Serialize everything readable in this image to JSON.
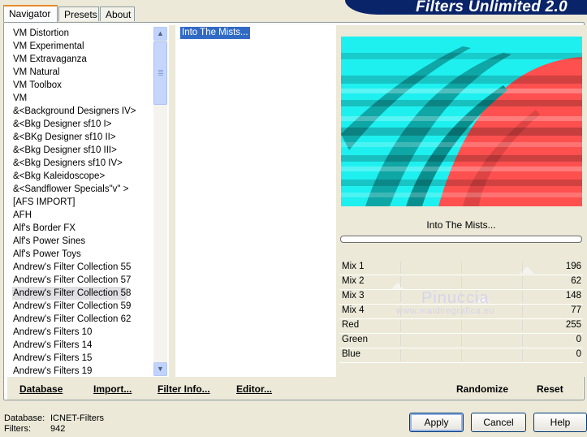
{
  "banner": {
    "title": "Filters Unlimited 2.0"
  },
  "tabs": [
    {
      "label": "Navigator"
    },
    {
      "label": "Presets"
    },
    {
      "label": "About"
    }
  ],
  "filter_list": {
    "items": [
      "VM Distortion",
      "VM Experimental",
      "VM Extravaganza",
      "VM Natural",
      "VM Toolbox",
      "VM",
      "&<Background Designers IV>",
      "&<Bkg Designer sf10 I>",
      "&<BKg Designer sf10 II>",
      "&<Bkg Designer sf10 III>",
      "&<Bkg Designers sf10 IV>",
      "&<Bkg Kaleidoscope>",
      "&<Sandflower Specials\"v\" >",
      "[AFS IMPORT]",
      "AFH",
      "Alf's Border FX",
      "Alf's Power Sines",
      "Alf's Power Toys",
      "Andrew's Filter Collection 55",
      "Andrew's Filter Collection 57",
      "Andrew's Filter Collection 58",
      "Andrew's Filter Collection 59",
      "Andrew's Filter Collection 62",
      "Andrew's Filters 10",
      "Andrew's Filters 14",
      "Andrew's Filters 15",
      "Andrew's Filters 19"
    ],
    "selected": "Andrew's Filter Collection 58"
  },
  "effect_list": {
    "selected": "Into The Mists..."
  },
  "filter_name": "Into The Mists...",
  "progress": 0,
  "sliders": [
    {
      "label": "Mix 1",
      "value": "196"
    },
    {
      "label": "Mix 2",
      "value": "62"
    },
    {
      "label": "Mix 3",
      "value": "148"
    },
    {
      "label": "Mix 4",
      "value": "77"
    },
    {
      "label": "Red",
      "value": "255"
    },
    {
      "label": "Green",
      "value": "0"
    },
    {
      "label": "Blue",
      "value": "0"
    }
  ],
  "watermark": {
    "name": "Pinuccia",
    "site": "www.maidiregrafica.eu"
  },
  "buttons": {
    "database": "Database",
    "import": "Import...",
    "filter_info": "Filter Info...",
    "editor": "Editor...",
    "randomize": "Randomize",
    "reset": "Reset",
    "apply": "Apply",
    "cancel": "Cancel",
    "help": "Help"
  },
  "status": {
    "database_label": "Database:",
    "database_value": "ICNET-Filters",
    "filters_label": "Filters:",
    "filters_value": "942"
  },
  "colors": {
    "preview_cyan": "#1ef0f0",
    "preview_red": "#ff5050",
    "selection": "#316ac5",
    "banner": "#0a246a"
  },
  "icons": {
    "scroll_up": "chevron-up-icon",
    "scroll_down": "chevron-down-icon"
  }
}
